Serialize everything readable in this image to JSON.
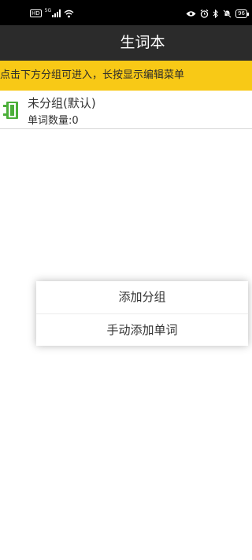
{
  "status_bar": {
    "hd_badge": "HD",
    "network_type": "5G",
    "battery_level": "96",
    "icons": [
      "hd-icon",
      "signal-icon",
      "wifi-icon",
      "eye-icon",
      "alarm-icon",
      "bluetooth-icon",
      "mute-icon",
      "battery-icon"
    ]
  },
  "app_bar": {
    "title": "生词本"
  },
  "hint": {
    "text": "点击下方分组可进入，长按显示编辑菜单"
  },
  "groups": [
    {
      "name": "未分组(默认)",
      "count_label": "单词数量:0",
      "icon": "notebook-icon"
    }
  ],
  "popup_menu": {
    "items": [
      {
        "label": "添加分组"
      },
      {
        "label": "手动添加单词"
      }
    ]
  },
  "colors": {
    "status_bar_bg": "#000000",
    "app_bar_bg": "#2b2b2b",
    "hint_bg": "#f8c916",
    "icon_green": "#4caf3a"
  }
}
